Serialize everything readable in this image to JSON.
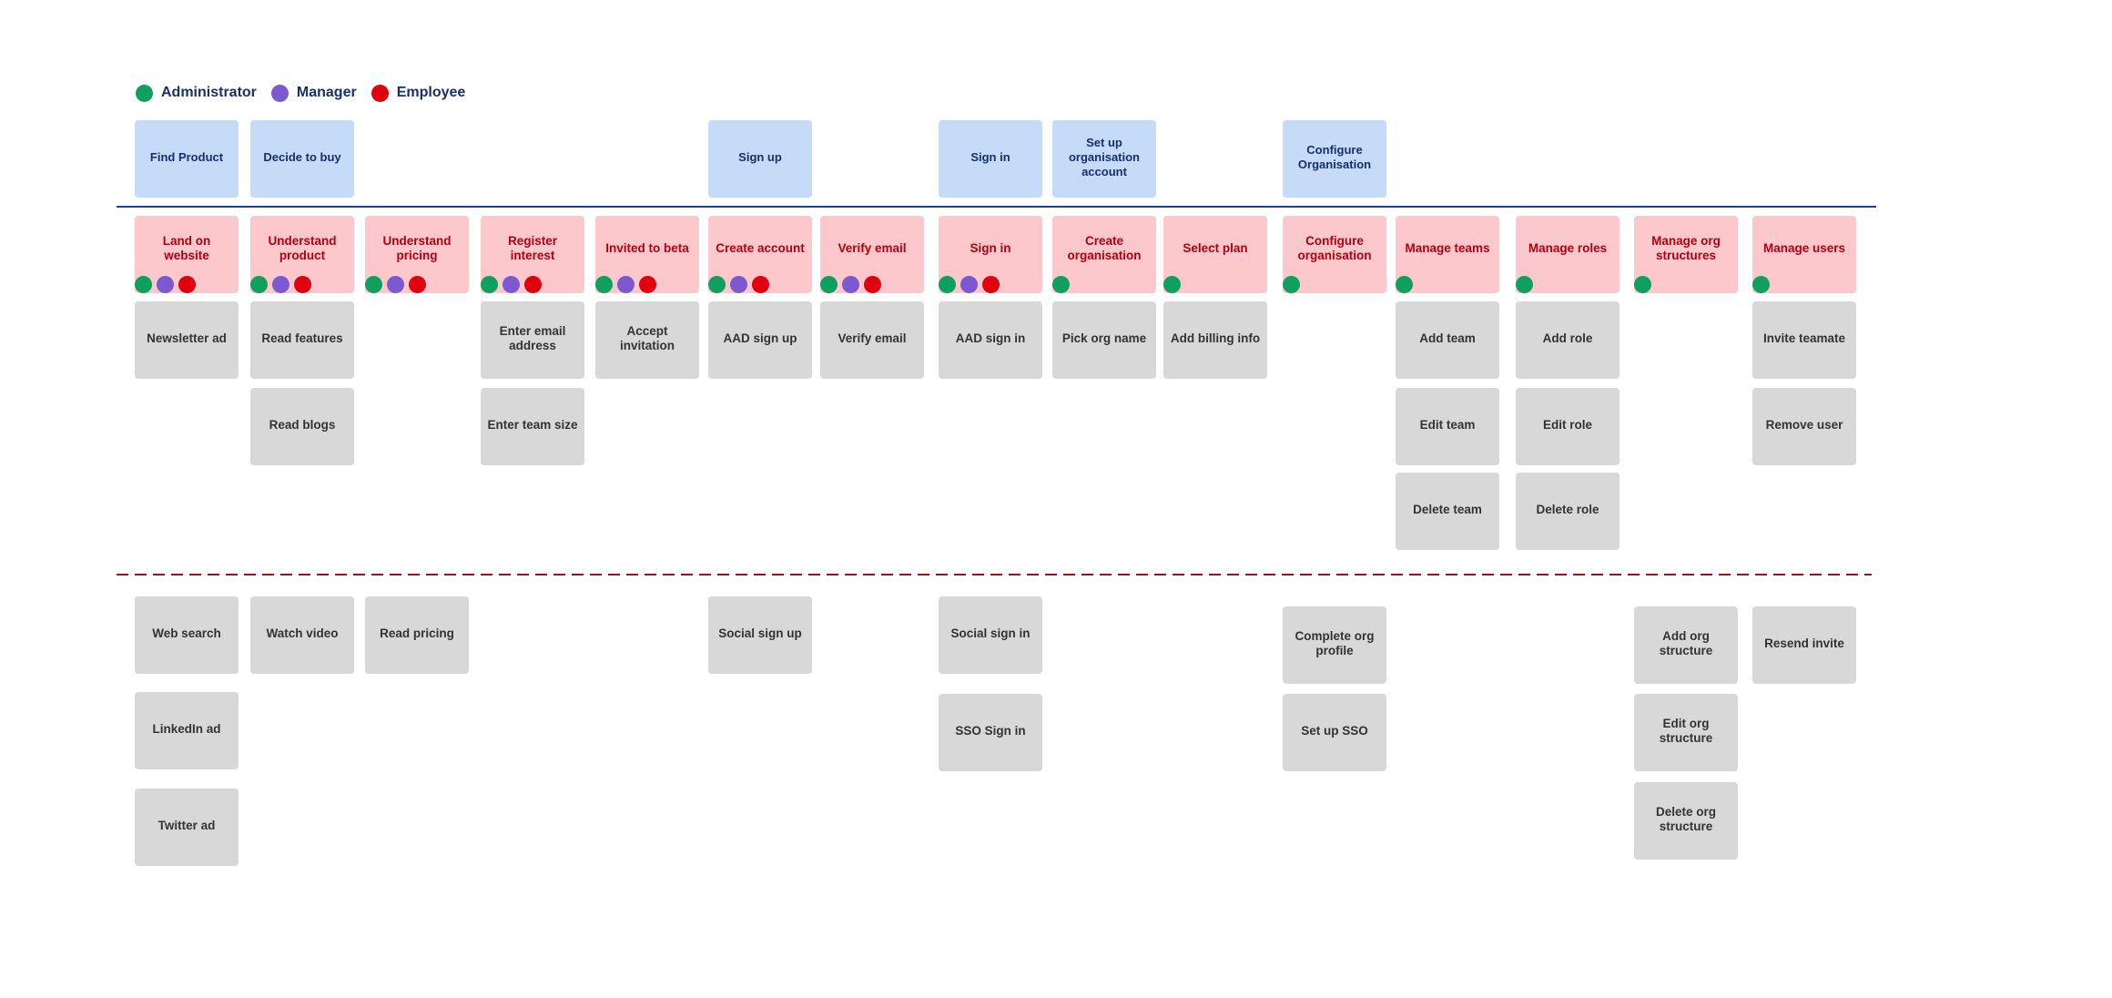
{
  "legend": [
    {
      "role": "administrator",
      "label": "Administrator",
      "color": "#0fa060"
    },
    {
      "role": "manager",
      "label": "Manager",
      "color": "#7b59d0"
    },
    {
      "role": "employee",
      "label": "Employee",
      "color": "#e0000e"
    }
  ],
  "colors": {
    "header_card": "#c6dbf7",
    "activity_card": "#fdc8cb",
    "task_card": "#d8d8d8",
    "header_text": "#17306b",
    "activity_text": "#b3000f",
    "task_text": "#333333",
    "backbone_line": "#1f3f86",
    "release_line": "#8b1a1a"
  },
  "headers": [
    {
      "col": 0,
      "label": "Find Product"
    },
    {
      "col": 1,
      "label": "Decide to buy"
    },
    {
      "col": 5,
      "label": "Sign up"
    },
    {
      "col": 7,
      "label": "Sign in"
    },
    {
      "col": 8,
      "label": "Set up organisation account"
    },
    {
      "col": 10,
      "label": "Configure Organisation"
    }
  ],
  "activities": [
    {
      "label": "Land on website",
      "roles": [
        "administrator",
        "manager",
        "employee"
      ]
    },
    {
      "label": "Understand product",
      "roles": [
        "administrator",
        "manager",
        "employee"
      ]
    },
    {
      "label": "Understand pricing",
      "roles": [
        "administrator",
        "manager",
        "employee"
      ]
    },
    {
      "label": "Register interest",
      "roles": [
        "administrator",
        "manager",
        "employee"
      ]
    },
    {
      "label": "Invited to beta",
      "roles": [
        "administrator",
        "manager",
        "employee"
      ]
    },
    {
      "label": "Create account",
      "roles": [
        "administrator",
        "manager",
        "employee"
      ]
    },
    {
      "label": "Verify email",
      "roles": [
        "administrator",
        "manager",
        "employee"
      ]
    },
    {
      "label": "Sign in",
      "roles": [
        "administrator",
        "manager",
        "employee"
      ]
    },
    {
      "label": "Create organisation",
      "roles": [
        "administrator"
      ]
    },
    {
      "label": "Select plan",
      "roles": [
        "administrator"
      ]
    },
    {
      "label": "Configure organisation",
      "roles": [
        "administrator"
      ]
    },
    {
      "label": "Manage teams",
      "roles": [
        "administrator"
      ]
    },
    {
      "label": "Manage roles",
      "roles": [
        "administrator"
      ]
    },
    {
      "label": "Manage org structures",
      "roles": [
        "administrator"
      ]
    },
    {
      "label": "Manage users",
      "roles": [
        "administrator"
      ]
    }
  ],
  "release_1_tasks": [
    {
      "col": 0,
      "row": 0,
      "label": "Newsletter ad"
    },
    {
      "col": 1,
      "row": 0,
      "label": "Read features"
    },
    {
      "col": 1,
      "row": 1,
      "label": "Read blogs"
    },
    {
      "col": 3,
      "row": 0,
      "label": "Enter email address"
    },
    {
      "col": 3,
      "row": 1,
      "label": "Enter team size"
    },
    {
      "col": 4,
      "row": 0,
      "label": "Accept invitation"
    },
    {
      "col": 5,
      "row": 0,
      "label": "AAD sign up"
    },
    {
      "col": 6,
      "row": 0,
      "label": "Verify email"
    },
    {
      "col": 7,
      "row": 0,
      "label": "AAD sign in"
    },
    {
      "col": 8,
      "row": 0,
      "label": "Pick org name"
    },
    {
      "col": 9,
      "row": 0,
      "label": "Add billing info"
    },
    {
      "col": 11,
      "row": 0,
      "label": "Add team"
    },
    {
      "col": 11,
      "row": 1,
      "label": "Edit team"
    },
    {
      "col": 11,
      "row": 2,
      "label": "Delete team"
    },
    {
      "col": 12,
      "row": 0,
      "label": "Add role"
    },
    {
      "col": 12,
      "row": 1,
      "label": "Edit role"
    },
    {
      "col": 12,
      "row": 2,
      "label": "Delete role"
    },
    {
      "col": 14,
      "row": 0,
      "label": "Invite teamate"
    },
    {
      "col": 14,
      "row": 1,
      "label": "Remove user"
    }
  ],
  "release_2_tasks": [
    {
      "col": 0,
      "row": 0,
      "label": "Web search"
    },
    {
      "col": 0,
      "row": 1,
      "label": "LinkedIn ad"
    },
    {
      "col": 0,
      "row": 2,
      "label": "Twitter ad"
    },
    {
      "col": 1,
      "row": 0,
      "label": "Watch video"
    },
    {
      "col": 2,
      "row": 0,
      "label": "Read pricing"
    },
    {
      "col": 5,
      "row": 0,
      "label": "Social sign up"
    },
    {
      "col": 7,
      "row": 0,
      "label": "Social sign in"
    },
    {
      "col": 7,
      "row": 1,
      "label": "SSO Sign in"
    },
    {
      "col": 10,
      "row": 0,
      "label": "Complete org profile"
    },
    {
      "col": 10,
      "row": 1,
      "label": "Set up SSO"
    },
    {
      "col": 13,
      "row": 0,
      "label": "Add org structure"
    },
    {
      "col": 13,
      "row": 1,
      "label": "Edit org structure"
    },
    {
      "col": 13,
      "row": 2,
      "label": "Delete org structure"
    },
    {
      "col": 14,
      "row": 0,
      "label": "Resend invite"
    }
  ]
}
